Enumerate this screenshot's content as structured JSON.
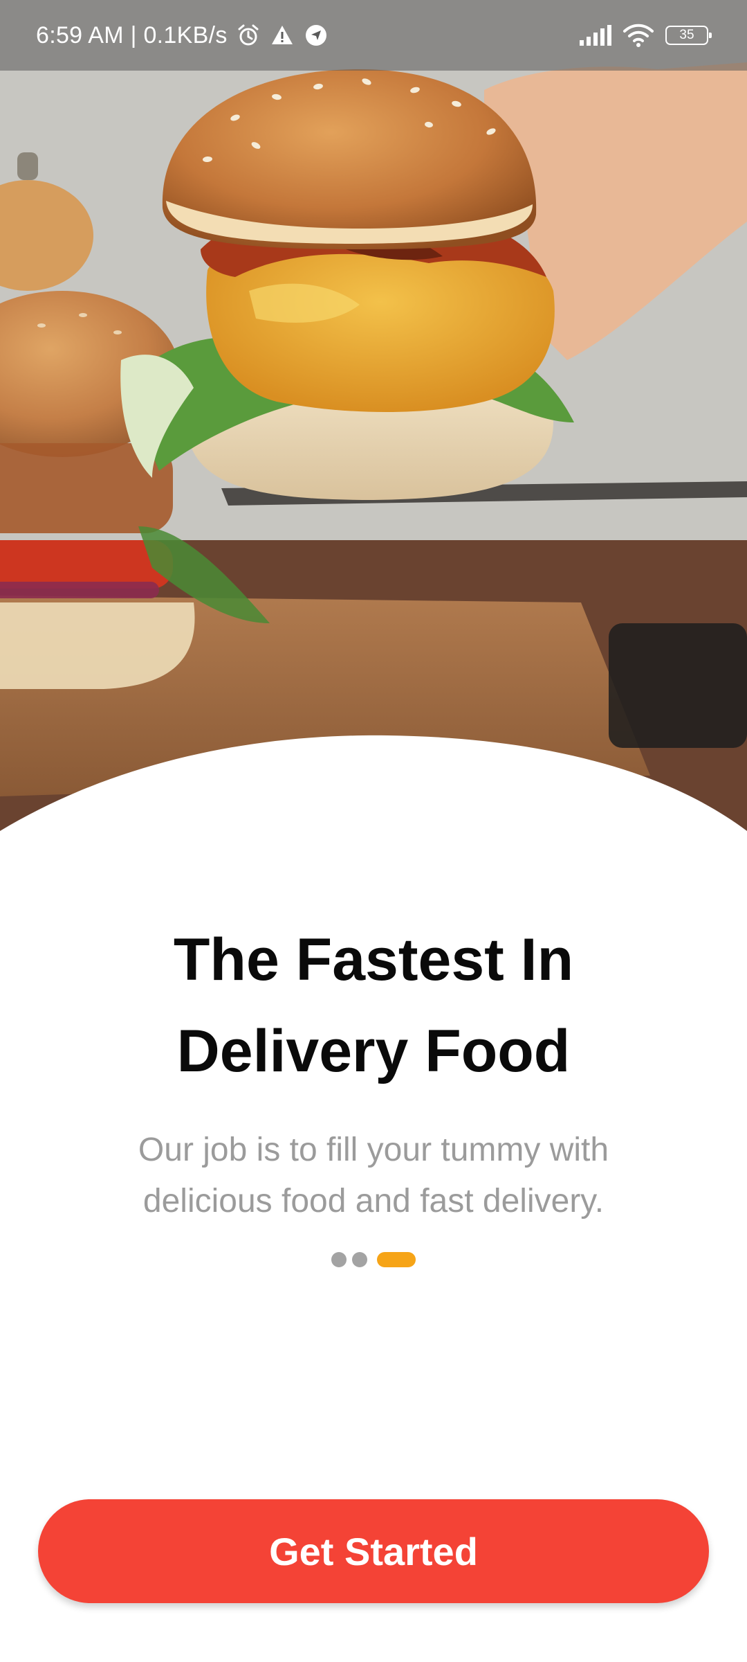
{
  "status_bar": {
    "time": "6:59 AM | 0.1KB/s",
    "icons_left": [
      "alarm-icon",
      "warning-icon",
      "location-icon"
    ],
    "icons_right": [
      "signal-icon",
      "wifi-icon",
      "battery-icon"
    ],
    "battery_level": "35"
  },
  "hero": {
    "image_subject": "burger-photo"
  },
  "onboarding": {
    "title": "The Fastest In Delivery Food",
    "subtitle": "Our job is to fill your tummy with delicious food and fast delivery.",
    "page_count": 3,
    "active_page": 3
  },
  "cta": {
    "label": "Get Started"
  },
  "colors": {
    "accent": "#f44336",
    "indicator_active": "#f6a417",
    "indicator_inactive": "#a3a3a3",
    "subtitle": "#9b9b9b"
  }
}
